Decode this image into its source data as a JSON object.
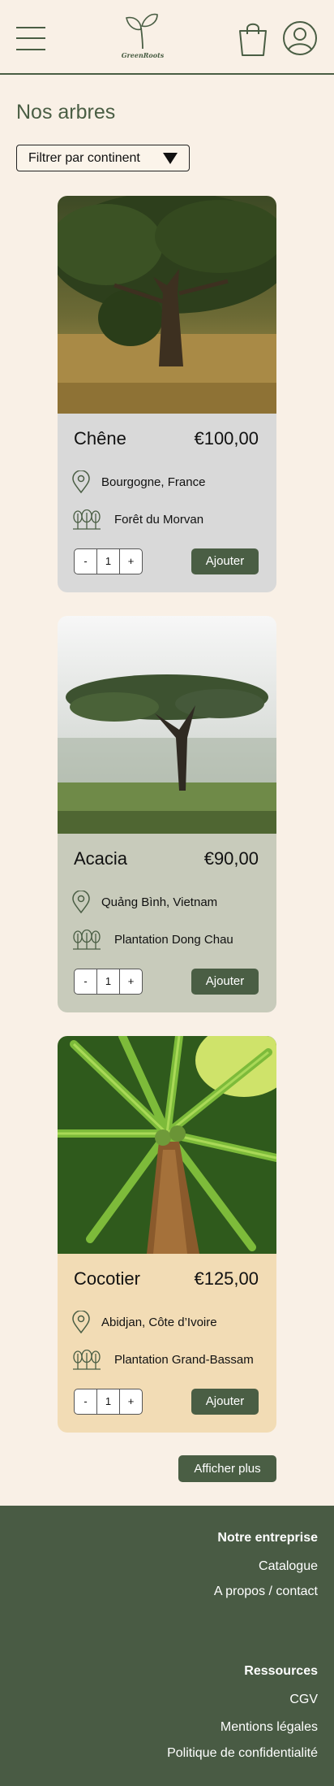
{
  "header": {
    "logo_text": "GreenRoots"
  },
  "page": {
    "title": "Nos arbres",
    "filter_label": "Filtrer par continent"
  },
  "products": [
    {
      "name": "Chêne",
      "price": "€100,00",
      "location": "Bourgogne, France",
      "forest": "Forêt du Morvan",
      "quantity": "1",
      "minus": "-",
      "plus": "+",
      "add_label": "Ajouter",
      "bg_color": "#d9d9d9"
    },
    {
      "name": "Acacia",
      "price": "€90,00",
      "location": "Quảng Bình, Vietnam",
      "forest": "Plantation Dong Chau",
      "quantity": "1",
      "minus": "-",
      "plus": "+",
      "add_label": "Ajouter",
      "bg_color": "#c8cbbb"
    },
    {
      "name": "Cocotier",
      "price": "€125,00",
      "location": "Abidjan, Côte d’Ivoire",
      "forest": "Plantation Grand-Bassam",
      "quantity": "1",
      "minus": "-",
      "plus": "+",
      "add_label": "Ajouter",
      "bg_color": "#f2dcb5"
    }
  ],
  "more_label": "Afficher plus",
  "footer": {
    "company_heading": "Notre entreprise",
    "company_links": [
      "Catalogue",
      "A propos / contact"
    ],
    "resources_heading": "Ressources",
    "resources_links": [
      "CGV",
      "Mentions légales",
      "Politique de confidentialité"
    ]
  },
  "colors": {
    "brand": "#4a5e44",
    "background": "#f9f0e6",
    "footer": "#495b44"
  }
}
